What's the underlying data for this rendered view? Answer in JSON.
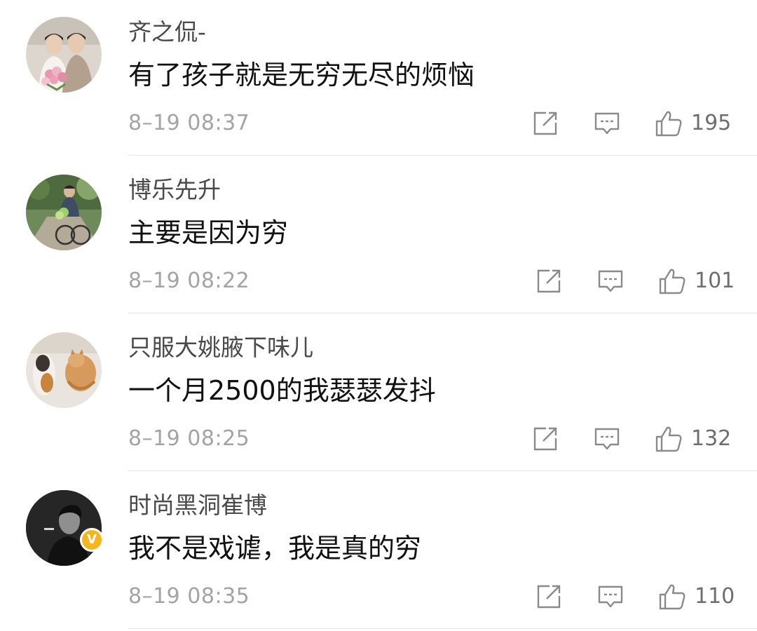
{
  "comments": [
    {
      "username": "齐之侃-",
      "text": "有了孩子就是无穷无尽的烦恼",
      "time": "8–19 08:37",
      "likes": "195",
      "verified": false
    },
    {
      "username": "博乐先升",
      "text": "主要是因为穷",
      "time": "8–19 08:22",
      "likes": "101",
      "verified": false
    },
    {
      "username": "只服大姚腋下味儿",
      "text": "一个月2500的我瑟瑟发抖",
      "time": "8–19 08:25",
      "likes": "132",
      "verified": false
    },
    {
      "username": "时尚黑洞崔博",
      "text": "我不是戏谑，我是真的穷",
      "time": "8–19 08:35",
      "likes": "110",
      "verified": true,
      "badge": "V"
    }
  ],
  "icons": {
    "share": "share-icon",
    "reply": "comment-icon",
    "like": "thumbs-up-icon"
  },
  "colors": {
    "text": "#111111",
    "username": "#4a4a4a",
    "meta": "#a4a4a4",
    "icon": "#8a8a8a",
    "badge": "#f5b71c"
  }
}
